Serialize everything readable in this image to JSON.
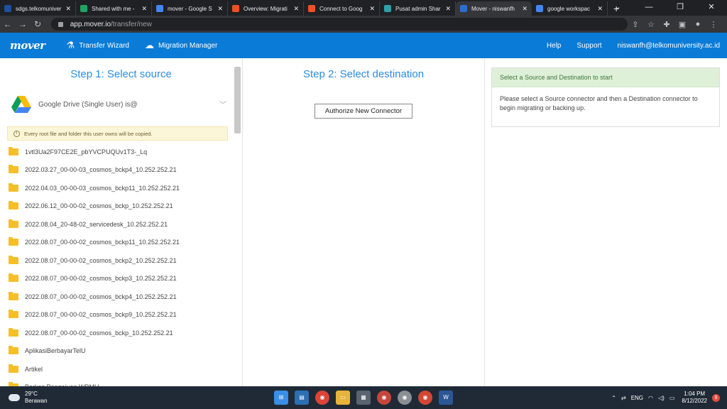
{
  "browser": {
    "tabs": [
      {
        "label": "sdgs.telkomuniver",
        "color": "#1e4fa0",
        "active": false
      },
      {
        "label": "Shared with me -",
        "color": "#1fa463",
        "active": false
      },
      {
        "label": "mover - Google S",
        "color": "#4285f4",
        "active": false
      },
      {
        "label": "Overview: Migrati",
        "color": "#f25022",
        "active": false
      },
      {
        "label": "Connect to Goog",
        "color": "#f25022",
        "active": false
      },
      {
        "label": "Pusat admin Shar",
        "color": "#2ea0a8",
        "active": false
      },
      {
        "label": "Mover - niswanfh",
        "color": "#2a6dd8",
        "active": true
      },
      {
        "label": "google workspac",
        "color": "#4285f4",
        "active": false
      }
    ],
    "url_host": "app.mover.io",
    "url_path": "/transfer/new"
  },
  "nav": {
    "logo": "mover",
    "transfer_wizard": "Transfer Wizard",
    "migration_manager": "Migration Manager",
    "help": "Help",
    "support": "Support",
    "user": "niswanfh@telkomuniversity.ac.id"
  },
  "step1": {
    "title": "Step 1: Select source",
    "source": "Google Drive (Single User) is@",
    "notice": "Every root file and folder this user owns will be copied.",
    "files": [
      "1vtl3Ua2F97CE2E_pbYVCPUQUv1T3-_Lq",
      "2022.03.27_00-00-03_cosmos_bckp4_10.252.252.21",
      "2022.04.03_00-00-03_cosmos_bckp11_10.252.252.21",
      "2022.06.12_00-00-02_cosmos_bckp_10.252.252.21",
      "2022.08.04_20-48-02_servicedesk_10.252.252.21",
      "2022.08.07_00-00-02_cosmos_bckp11_10.252.252.21",
      "2022.08.07_00-00-02_cosmos_bckp2_10.252.252.21",
      "2022.08.07_00-00-02_cosmos_bckp3_10.252.252.21",
      "2022.08.07_00-00-02_cosmos_bckp4_10.252.252.21",
      "2022.08.07_00-00-02_cosmos_bckp9_10.252.252.21",
      "2022.08.07_00-00-02_cosmos_bckp_10.252.252.21",
      "AplikasiBerbayarTelU",
      "Artikel",
      "Berkas Pengajuan WBMU"
    ]
  },
  "step2": {
    "title": "Step 2: Select destination",
    "authorize": "Authorize New Connector"
  },
  "info": {
    "heading": "Select a Source and Destination to start",
    "body": "Please select a Source connector and then a Destination connector to begin migrating or backing up."
  },
  "taskbar": {
    "temp": "29°C",
    "weather": "Berawan",
    "lang": "ENG",
    "time": "1:04 PM",
    "date": "8/12/2022",
    "notifications": "9"
  }
}
